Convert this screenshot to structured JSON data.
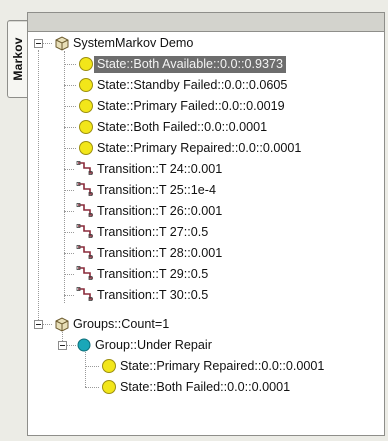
{
  "side_tab": {
    "label": "Markov"
  },
  "tree": {
    "root": {
      "label": "SystemMarkov Demo",
      "icon": "package-icon"
    },
    "states": [
      {
        "label": "State::Both Available::0.0::0.9373",
        "selected": true
      },
      {
        "label": "State::Standby Failed::0.0::0.0605"
      },
      {
        "label": "State::Primary Failed::0.0::0.0019"
      },
      {
        "label": "State::Both Failed::0.0::0.0001"
      },
      {
        "label": "State::Primary Repaired::0.0::0.0001"
      }
    ],
    "transitions": [
      {
        "label": "Transition::T 24::0.001"
      },
      {
        "label": "Transition::T 25::1e-4"
      },
      {
        "label": "Transition::T 26::0.001"
      },
      {
        "label": "Transition::T 27::0.5"
      },
      {
        "label": "Transition::T 28::0.001"
      },
      {
        "label": "Transition::T 29::0.5"
      },
      {
        "label": "Transition::T 30::0.5"
      }
    ],
    "groups": {
      "label": "Groups::Count=1",
      "group": {
        "label": "Group::Under Repair",
        "states": [
          {
            "label": "State::Primary Repaired::0.0::0.0001"
          },
          {
            "label": "State::Both Failed::0.0::0.0001"
          }
        ]
      }
    }
  },
  "colors": {
    "state_icon": "#f2e61a",
    "group_icon": "#1aa7b8",
    "transition_icon": "#8a2a3a",
    "selection": "#6d6d6d"
  }
}
